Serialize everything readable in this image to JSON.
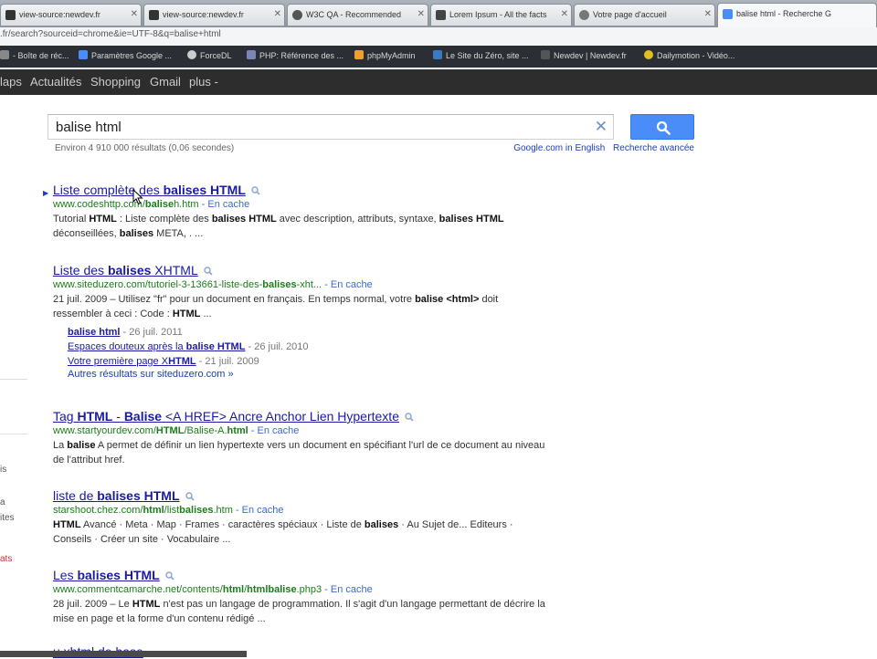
{
  "browser": {
    "tabs": [
      {
        "label": "view-source:newdev.fr",
        "icon_color": "#333333"
      },
      {
        "label": "view-source:newdev.fr",
        "icon_color": "#333333"
      },
      {
        "label": "W3C QA - Recommended",
        "icon_color": "#555555"
      },
      {
        "label": "Lorem Ipsum - All the facts",
        "icon_color": "#444444"
      },
      {
        "label": "Votre page d'accueil",
        "icon_color": "#777777"
      },
      {
        "label": "balise html - Recherche G",
        "icon_color": "#4b8df8"
      }
    ],
    "address": ".fr/search?sourceid=chrome&ie=UTF-8&q=balise+html",
    "bookmarks": [
      {
        "label": "- Boîte de réc...",
        "icon_color": "#888888"
      },
      {
        "label": "Paramètres Google ...",
        "icon_color": "#4b8df8"
      },
      {
        "label": "ForceDL",
        "icon_color": "#cccccc"
      },
      {
        "label": "PHP: Référence des ...",
        "icon_color": "#7a86b8"
      },
      {
        "label": "phpMyAdmin",
        "icon_color": "#f0a030"
      },
      {
        "label": "Le Site du Zéro, site ...",
        "icon_color": "#3a7ac4"
      },
      {
        "label": "Newdev | Newdev.fr",
        "icon_color": "#555555"
      },
      {
        "label": "Dailymotion - Vidéo...",
        "icon_color": "#e0c020"
      }
    ]
  },
  "google_bar": [
    "laps",
    "Actualités",
    "Shopping",
    "Gmail",
    "plus -"
  ],
  "search": {
    "query": "balise html",
    "stats": "Environ 4 910 000 résultats (0,06 secondes)",
    "links": [
      "Google.com in English",
      "Recherche avancée"
    ],
    "button_color": "#4b8df8"
  },
  "results": [
    {
      "title_parts": [
        [
          "Liste complète des ",
          false
        ],
        [
          "balises HTML",
          true
        ]
      ],
      "url": "www.codeshttp.com/baliseh.htm",
      "cache": "En cache",
      "snippet": "Tutorial HTML : Liste complète des balises HTML avec description, attributs, syntaxe, balises HTML déconseillées, balises META, . ..."
    },
    {
      "title_parts": [
        [
          "Liste des ",
          false
        ],
        [
          "balises",
          true
        ],
        [
          " XHTML",
          false
        ]
      ],
      "url": "www.siteduzero.com/tutoriel-3-13661-liste-des-balises-xht...",
      "cache": "En cache",
      "snippet": "21 juil. 2009 – Utilisez \"fr\" pour un document en français. En temps normal, votre balise <html> doit ressembler à ceci : Code : HTML ...",
      "sublinks": [
        {
          "title": "balise html",
          "date": "26 juil. 2011"
        },
        {
          "title": "Espaces douteux après la balise HTML",
          "date": "26 juil. 2010"
        },
        {
          "title": "Votre première page XHTML",
          "date": "21 juil. 2009"
        }
      ],
      "more": "Autres résultats sur siteduzero.com »"
    },
    {
      "title_parts": [
        [
          "Tag ",
          false
        ],
        [
          "HTML",
          true
        ],
        [
          " - ",
          false
        ],
        [
          "Balise",
          true
        ],
        [
          " <A HREF> Ancre Anchor Lien Hypertexte",
          false
        ]
      ],
      "url": "www.startyourdev.com/HTML/Balise-A.html",
      "cache": "En cache",
      "snippet": "La balise A permet de définir un lien hypertexte vers un document en spécifiant l'url de ce document au niveau de l'attribut href."
    },
    {
      "title_parts": [
        [
          "liste de ",
          false
        ],
        [
          "balises HTML",
          true
        ]
      ],
      "url": "starshoot.chez.com/html/listbalises.htm",
      "cache": "En cache",
      "snippet": "HTML Avancé · Meta · Map · Frames · caractères spéciaux · Liste de balises · Au Sujet de... Editeurs · Conseils · Créer un site · Vocabulaire ..."
    },
    {
      "title_parts": [
        [
          "Les ",
          false
        ],
        [
          "balises HTML",
          true
        ]
      ],
      "url": "www.commentcamarche.net/contents/html/htmlbalise.php3",
      "cache": "En cache",
      "snippet": "28 juil. 2009 – Le HTML n'est pas un langage de programmation. Il s'agit d'un langage permettant de décrire la mise en page et la forme d'un contenu rédigé ..."
    },
    {
      "title_parts": [
        [
          "u xhtml de base",
          false
        ]
      ],
      "url": "",
      "cache": "",
      "snippet": ""
    }
  ],
  "side_fragments": [
    "is",
    "a",
    "ites",
    "ats"
  ],
  "side_fragment_accent": "#cc3333"
}
